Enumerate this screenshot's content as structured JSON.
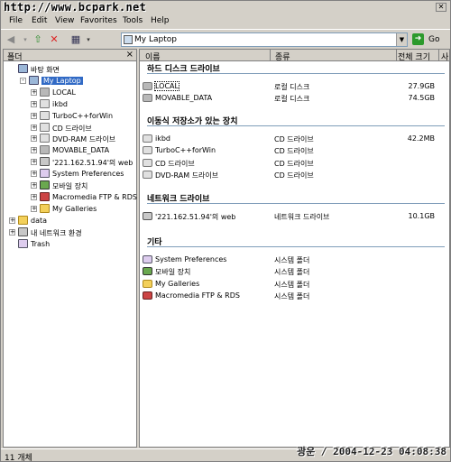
{
  "watermark": "http://www.bcpark.net",
  "menu": [
    "File",
    "Edit",
    "View",
    "Favorites",
    "Tools",
    "Help"
  ],
  "address": {
    "value": "My Laptop",
    "go_label": "Go"
  },
  "left_panel": {
    "title": "폴더",
    "tree": [
      {
        "label": "바탕 화면",
        "indent": 0,
        "expander": "",
        "icon": "desktop-icon",
        "cls": "comp"
      },
      {
        "label": "My Laptop",
        "indent": 1,
        "expander": "-",
        "icon": "computer-icon",
        "cls": "comp",
        "selected": true
      },
      {
        "label": "LOCAL",
        "indent": 2,
        "expander": "+",
        "icon": "hard-disk-icon",
        "cls": "hd"
      },
      {
        "label": "ikbd",
        "indent": 2,
        "expander": "+",
        "icon": "cd-drive-icon",
        "cls": "cd"
      },
      {
        "label": "TurboC++forWin",
        "indent": 2,
        "expander": "+",
        "icon": "cd-drive-icon",
        "cls": "cd"
      },
      {
        "label": "CD 드라이브",
        "indent": 2,
        "expander": "+",
        "icon": "cd-drive-icon",
        "cls": "cd"
      },
      {
        "label": "DVD-RAM 드라이브",
        "indent": 2,
        "expander": "+",
        "icon": "dvd-drive-icon",
        "cls": "cd"
      },
      {
        "label": "MOVABLE_DATA",
        "indent": 2,
        "expander": "+",
        "icon": "hard-disk-icon",
        "cls": "hd"
      },
      {
        "label": "'221.162.51.94'의 web",
        "indent": 2,
        "expander": "+",
        "icon": "network-drive-icon",
        "cls": "net"
      },
      {
        "label": "System Preferences",
        "indent": 2,
        "expander": "+",
        "icon": "system-preferences-icon",
        "cls": "sys"
      },
      {
        "label": "모바일 장치",
        "indent": 2,
        "expander": "+",
        "icon": "mobile-device-icon",
        "cls": "phone"
      },
      {
        "label": "Macromedia FTP & RDS",
        "indent": 2,
        "expander": "+",
        "icon": "macromedia-icon",
        "cls": "mm"
      },
      {
        "label": "My Galleries",
        "indent": 2,
        "expander": "+",
        "icon": "galleries-icon",
        "cls": "fold"
      },
      {
        "label": "data",
        "indent": 0,
        "expander": "+",
        "icon": "folder-icon",
        "cls": "fold"
      },
      {
        "label": "내 네트워크 환경",
        "indent": 0,
        "expander": "+",
        "icon": "network-icon",
        "cls": "net"
      },
      {
        "label": "Trash",
        "indent": 0,
        "expander": "",
        "icon": "trash-icon",
        "cls": "sys"
      }
    ]
  },
  "columns": {
    "name": "이름",
    "type": "종류",
    "total": "전체 크기",
    "free": "사"
  },
  "groups": [
    {
      "title": "하드 디스크 드라이브",
      "items": [
        {
          "name": "LOCAL",
          "type": "로컬 디스크",
          "size": "27.9GB",
          "icon": "hard-disk-icon",
          "cls": "hd",
          "focused": true
        },
        {
          "name": "MOVABLE_DATA",
          "type": "로컬 디스크",
          "size": "74.5GB",
          "icon": "hard-disk-icon",
          "cls": "hd"
        }
      ]
    },
    {
      "title": "이동식 저장소가 있는 장치",
      "items": [
        {
          "name": "ikbd",
          "type": "CD 드라이브",
          "size": "42.2MB",
          "icon": "cd-drive-icon",
          "cls": "cd"
        },
        {
          "name": "TurboC++forWin",
          "type": "CD 드라이브",
          "size": "",
          "icon": "cd-drive-icon",
          "cls": "cd"
        },
        {
          "name": "CD 드라이브",
          "type": "CD 드라이브",
          "size": "",
          "icon": "cd-drive-icon",
          "cls": "cd"
        },
        {
          "name": "DVD-RAM 드라이브",
          "type": "CD 드라이브",
          "size": "",
          "icon": "dvd-drive-icon",
          "cls": "cd"
        }
      ]
    },
    {
      "title": "네트워크 드라이브",
      "items": [
        {
          "name": "'221.162.51.94'의 web",
          "type": "네트워크 드라이브",
          "size": "10.1GB",
          "icon": "network-drive-icon",
          "cls": "net"
        }
      ]
    },
    {
      "title": "기타",
      "items": [
        {
          "name": "System Preferences",
          "type": "시스템 폴더",
          "size": "",
          "icon": "system-preferences-icon",
          "cls": "sys"
        },
        {
          "name": "모바일 장치",
          "type": "시스템 폴더",
          "size": "",
          "icon": "mobile-device-icon",
          "cls": "phone"
        },
        {
          "name": "My Galleries",
          "type": "시스템 폴더",
          "size": "",
          "icon": "galleries-icon",
          "cls": "fold"
        },
        {
          "name": "Macromedia FTP & RDS",
          "type": "시스템 폴더",
          "size": "",
          "icon": "macromedia-icon",
          "cls": "mm"
        }
      ]
    }
  ],
  "status": {
    "text": "11 개체",
    "stamp": "광운 / 2004-12-23 04:08:38"
  }
}
